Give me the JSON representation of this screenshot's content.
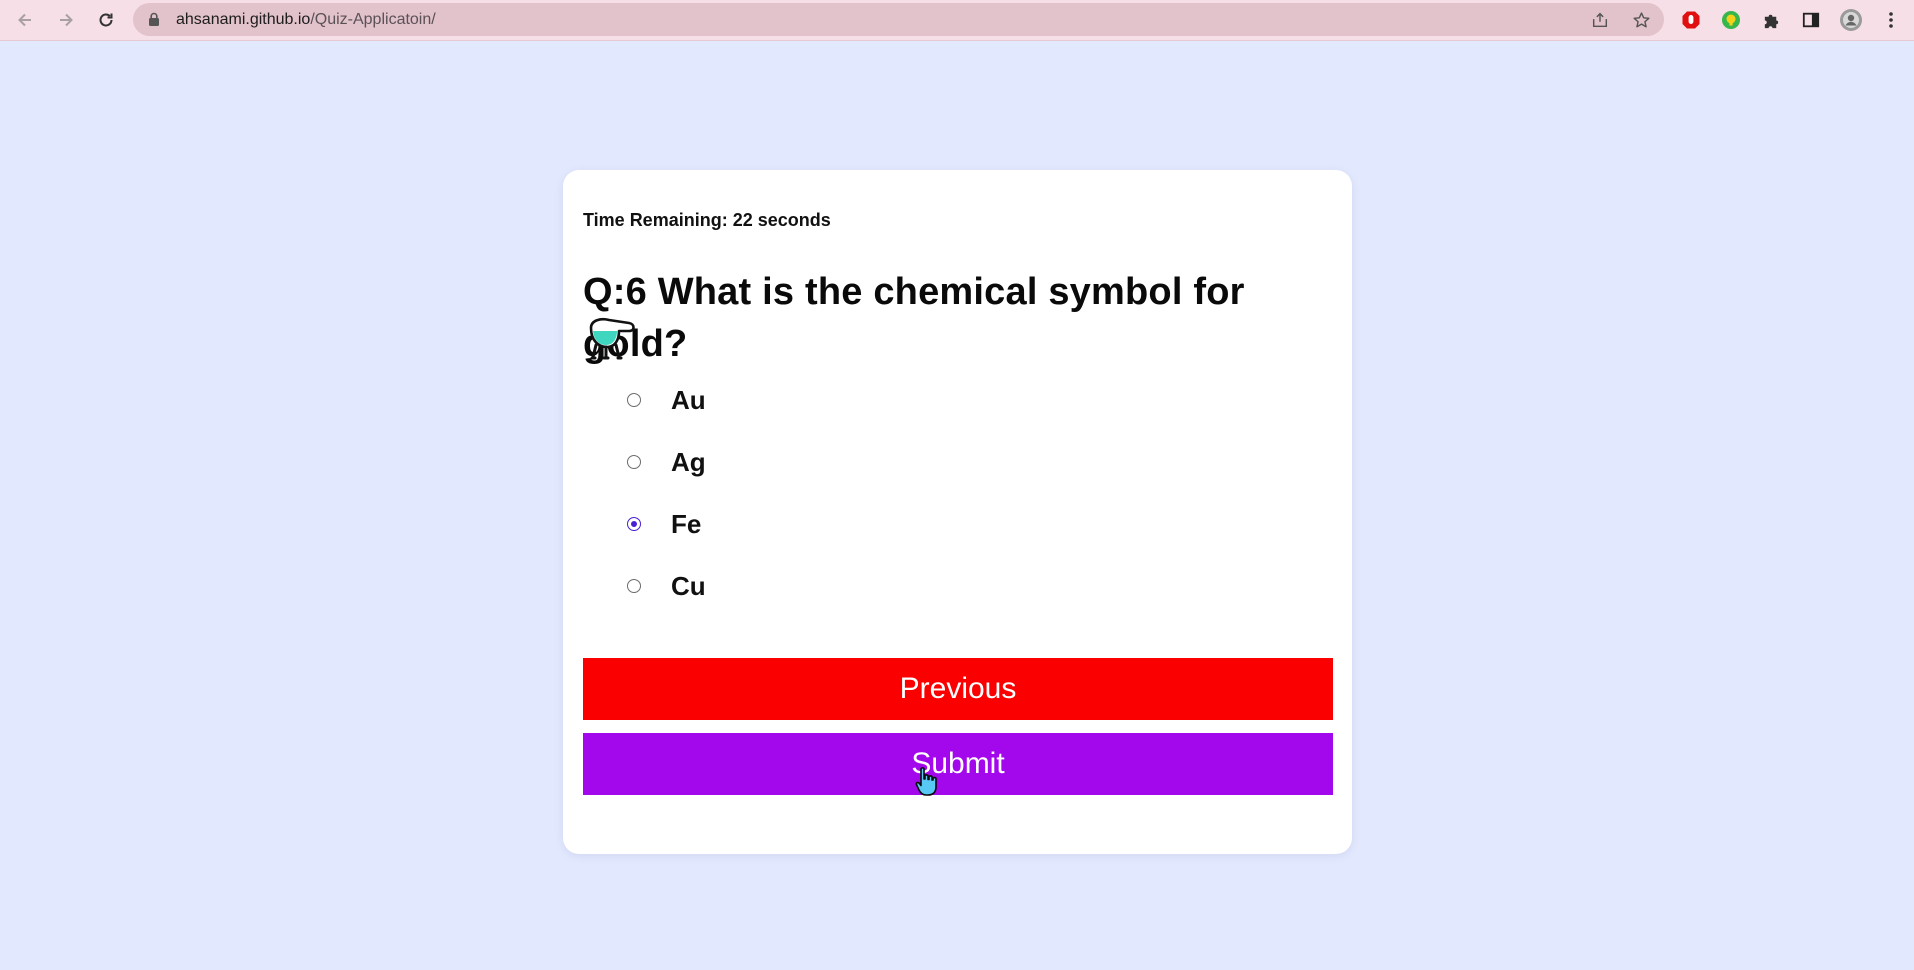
{
  "browser": {
    "url_host": "ahsanami.github.io",
    "url_path": "/Quiz-Applicatoin/",
    "icons": [
      "back-icon",
      "forward-icon",
      "reload-icon",
      "lock-icon",
      "share-icon",
      "star-icon",
      "extension-red-icon",
      "extension-green-icon",
      "puzzle-icon",
      "side-panel-icon",
      "profile-avatar",
      "menu-icon"
    ]
  },
  "quiz": {
    "timer_text": "Time Remaining: 22 seconds",
    "question": "Q:6 What is the chemical symbol for gold?",
    "question_icon": "test-tube-emoji",
    "options": [
      {
        "label": "Au",
        "selected": false
      },
      {
        "label": "Ag",
        "selected": false
      },
      {
        "label": "Fe",
        "selected": true
      },
      {
        "label": "Cu",
        "selected": false
      }
    ],
    "previous_label": "Previous",
    "submit_label": "Submit"
  },
  "colors": {
    "page_bg": "#e2e8fd",
    "previous_bg": "#fa0000",
    "submit_bg": "#a208eb",
    "radio_accent": "#4a1fd6"
  }
}
